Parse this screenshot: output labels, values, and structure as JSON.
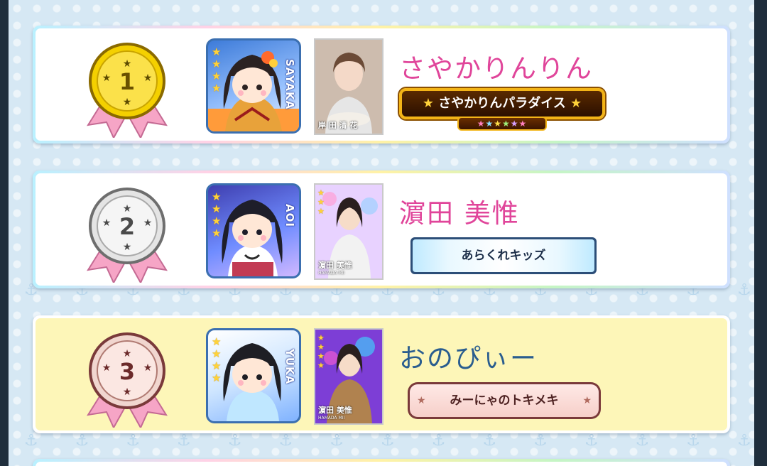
{
  "ranking": [
    {
      "rank": "1",
      "medal": "gold-medal",
      "avatar_name": "SAYAKA",
      "player_name": "さやかりんりん",
      "name_color": "#e0459a",
      "photo_caption": "岸 田 清 花",
      "title": "さやかりんパラダイス",
      "title_style": "gold-paradise",
      "highlighted": false
    },
    {
      "rank": "2",
      "medal": "silver-medal",
      "avatar_name": "AOI",
      "player_name": "濵田 美惟",
      "name_color": "#e0459a",
      "photo_caption": "濵田 美惟",
      "photo_caption_sub": "HAMADA MII",
      "title": "あらくれキッズ",
      "title_style": "blue-plate",
      "highlighted": false
    },
    {
      "rank": "3",
      "medal": "bronze-medal",
      "avatar_name": "YUKA",
      "player_name": "おのぴぃー",
      "name_color": "#2a5d8f",
      "photo_caption": "濵田 美惟",
      "photo_caption_sub": "HAMADA MII",
      "title": "みーにゃのトキメキ",
      "title_style": "pink-plate",
      "highlighted": true
    }
  ],
  "icons": {
    "anchor": "anchor-icon",
    "star": "star-icon"
  }
}
